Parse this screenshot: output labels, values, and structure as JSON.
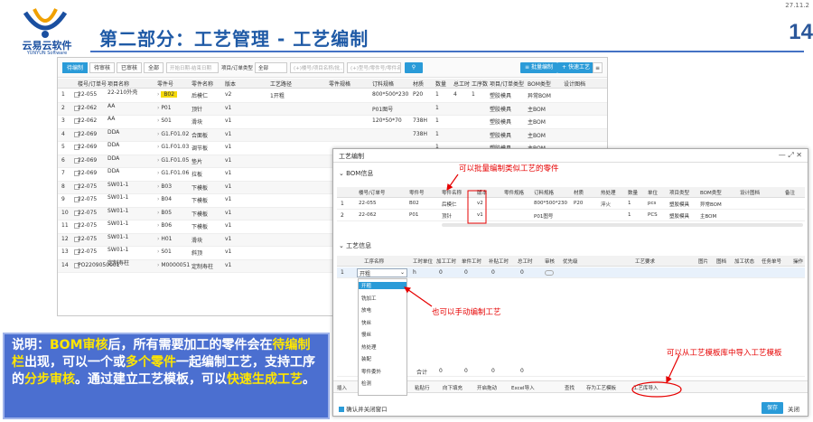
{
  "page": {
    "date": "27.11.2",
    "number": "14",
    "title": "第二部分：工艺管理 - 工艺编制"
  },
  "logo": {
    "name": "云易云软件",
    "sub": "YUNYUN Software"
  },
  "toolbar": {
    "tabs": [
      "待编制",
      "待审核",
      "已审核",
      "全部"
    ],
    "date_placeholder": "开始日期-结束日期",
    "project_label": "项目/订单类型",
    "project_value": "全部",
    "search_placeholder": "(+)楼号/项目名称/批...",
    "search2_placeholder": "(+)型号/零件号/零件名称",
    "batch_button": "批量编制",
    "quick_button": "快速工艺"
  },
  "main_table": {
    "headers": [
      "楼号/订单号",
      "项目名称",
      "零件号",
      "零件名称",
      "版本",
      "工艺路径",
      "零件规格",
      "订料规格",
      "材质",
      "数量",
      "总工时",
      "工序数",
      "项目/订单类型",
      "BOM类型",
      "设计图档"
    ],
    "rows": [
      {
        "n": "1",
        "order": "22-055",
        "project": "22-210外壳",
        "part": "B02",
        "name": "后模仁",
        "ver": "v2",
        "route": "1开粗",
        "spec": "",
        "order_spec": "800*500*230",
        "mat": "P20",
        "qty": "1",
        "hours": "4",
        "ops": "1",
        "type": "塑胶模具",
        "bom": "异常BOM"
      },
      {
        "n": "2",
        "order": "22-062",
        "project": "AA",
        "part": "P01",
        "name": "顶针",
        "ver": "v1",
        "route": "",
        "spec": "",
        "order_spec": "P01图号",
        "mat": "",
        "qty": "1",
        "hours": "",
        "ops": "",
        "type": "塑胶模具",
        "bom": "主BOM"
      },
      {
        "n": "3",
        "order": "22-062",
        "project": "AA",
        "part": "S01",
        "name": "滑块",
        "ver": "v1",
        "route": "",
        "spec": "",
        "order_spec": "120*50*70",
        "mat": "738H",
        "qty": "1",
        "hours": "",
        "ops": "",
        "type": "塑胶模具",
        "bom": "主BOM"
      },
      {
        "n": "4",
        "order": "22-069",
        "project": "DDA",
        "part": "G1.F01.02",
        "name": "合面板",
        "ver": "v1",
        "route": "",
        "spec": "",
        "order_spec": "",
        "mat": "738H",
        "qty": "1",
        "hours": "",
        "ops": "",
        "type": "塑胶模具",
        "bom": "主BOM"
      },
      {
        "n": "5",
        "order": "22-069",
        "project": "DDA",
        "part": "G1.F01.03",
        "name": "调节板",
        "ver": "v1",
        "route": "",
        "spec": "",
        "order_spec": "",
        "mat": "",
        "qty": "1",
        "hours": "",
        "ops": "",
        "type": "塑胶模具",
        "bom": "主BOM"
      },
      {
        "n": "6",
        "order": "22-069",
        "project": "DDA",
        "part": "G1.F01.05",
        "name": "垫片",
        "ver": "v1",
        "route": "",
        "spec": "",
        "order_spec": "",
        "mat": "",
        "qty": "1",
        "hours": "",
        "ops": "",
        "type": "塑胶模具",
        "bom": "主BOM"
      },
      {
        "n": "7",
        "order": "22-069",
        "project": "DDA",
        "part": "G1.F01.06",
        "name": "拉板",
        "ver": "v1",
        "route": "",
        "spec": "",
        "order_spec": "",
        "mat": "",
        "qty": "1",
        "hours": "",
        "ops": "",
        "type": "塑胶模具",
        "bom": "主BOM"
      },
      {
        "n": "8",
        "order": "22-075",
        "project": "SW01-1",
        "part": "B03",
        "name": "下模板",
        "ver": "v1",
        "route": "",
        "spec": "",
        "order_spec": "",
        "mat": "",
        "qty": "1",
        "hours": "",
        "ops": "",
        "type": "塑胶模具",
        "bom": "主BOM"
      },
      {
        "n": "9",
        "order": "22-075",
        "project": "SW01-1",
        "part": "B04",
        "name": "下模板",
        "ver": "v1",
        "route": "",
        "spec": "",
        "order_spec": "",
        "mat": "",
        "qty": "1",
        "hours": "",
        "ops": "",
        "type": "塑胶模具",
        "bom": "主BOM"
      },
      {
        "n": "10",
        "order": "22-075",
        "project": "SW01-1",
        "part": "B05",
        "name": "下模板",
        "ver": "v1",
        "route": "",
        "spec": "",
        "order_spec": "",
        "mat": "",
        "qty": "1",
        "hours": "",
        "ops": "",
        "type": "塑胶模具",
        "bom": "主BOM"
      },
      {
        "n": "11",
        "order": "22-075",
        "project": "SW01-1",
        "part": "B06",
        "name": "下模板",
        "ver": "v1",
        "route": "",
        "spec": "",
        "order_spec": "",
        "mat": "",
        "qty": "1",
        "hours": "",
        "ops": "",
        "type": "塑胶模具",
        "bom": "主BOM"
      },
      {
        "n": "12",
        "order": "22-075",
        "project": "SW01-1",
        "part": "H01",
        "name": "滑块",
        "ver": "v1",
        "route": "",
        "spec": "",
        "order_spec": "",
        "mat": "",
        "qty": "1",
        "hours": "",
        "ops": "",
        "type": "塑胶模具",
        "bom": "主BOM"
      },
      {
        "n": "13",
        "order": "22-075",
        "project": "SW01-1",
        "part": "S01",
        "name": "斜顶",
        "ver": "v1",
        "route": "",
        "spec": "",
        "order_spec": "",
        "mat": "",
        "qty": "1",
        "hours": "",
        "ops": "",
        "type": "塑胶模具",
        "bom": "主BOM"
      },
      {
        "n": "14",
        "order": "PO2209050001",
        "project": "定制寿柱",
        "part": "M0000051",
        "name": "定制寿柱",
        "ver": "v1",
        "route": "",
        "spec": "",
        "order_spec": "",
        "mat": "",
        "qty": "1",
        "hours": "",
        "ops": "",
        "type": "",
        "bom": ""
      }
    ]
  },
  "dialog": {
    "title": "工艺编制",
    "bom_section": "BOM信息",
    "bom_headers": [
      "楼号/订单号",
      "零件号",
      "零件名称",
      "版本",
      "零件规格",
      "订料规格",
      "材质",
      "热处理",
      "数量",
      "单位",
      "项目类型",
      "BOM类型",
      "设计图档",
      "备注"
    ],
    "bom_rows": [
      {
        "n": "1",
        "order": "22-055",
        "part": "B02",
        "name": "后模仁",
        "ver": "v2",
        "spec": "",
        "order_spec": "800*500*230",
        "mat": "P20",
        "heat": "淬火",
        "qty": "1",
        "unit": "pcs",
        "type": "塑胶模具",
        "bom": "异常BOM"
      },
      {
        "n": "2",
        "order": "22-062",
        "part": "P01",
        "name": "顶针",
        "ver": "v1",
        "spec": "",
        "order_spec": "P01图号",
        "mat": "",
        "heat": "",
        "qty": "1",
        "unit": "PCS",
        "type": "塑胶模具",
        "bom": "主BOM"
      }
    ],
    "process_section": "工艺信息",
    "process_headers": [
      "工序名称",
      "工时单位",
      "加工工时",
      "单件工时",
      "补贴工时",
      "总工时",
      "审核",
      "优先级",
      "工艺要求",
      "图片",
      "图档",
      "加工状态",
      "任务单号",
      "操作"
    ],
    "process_row": {
      "n": "1",
      "name": "开粗",
      "unit": "h",
      "h1": "0",
      "h2": "0",
      "h3": "0",
      "total": "0"
    },
    "dropdown": [
      "开粗",
      "铣加工",
      "放电",
      "快丝",
      "慢丝",
      "热处理",
      "装配",
      "零件委外",
      "检测"
    ],
    "total_label": "合计",
    "totals": [
      "0",
      "0",
      "0",
      "0"
    ],
    "footer_buttons": [
      "插入",
      "删除行",
      "复制行",
      "粘贴行",
      "向下填充",
      "开启拖动",
      "Excel导入",
      "查找",
      "存为工艺模板",
      "工艺库导入"
    ],
    "confirm_check": "确认并关闭窗口",
    "save": "保存",
    "close": "关闭"
  },
  "annotations": {
    "batch": "可以批量编制类似工艺的零件",
    "manual": "也可以手动编制工艺",
    "template": "可以从工艺模板库中导入工艺模板"
  },
  "note_segments": [
    {
      "t": "说明：",
      "b": false
    },
    {
      "t": "BOM审核",
      "b": true
    },
    {
      "t": "后，所有需要加工的零件会在",
      "b": false
    },
    {
      "t": "待编制栏",
      "b": true
    },
    {
      "t": "出现，可以一个或",
      "b": false
    },
    {
      "t": "多个零件",
      "b": true
    },
    {
      "t": "一起编制工艺，支持工序的",
      "b": false
    },
    {
      "t": "分步审核",
      "b": true
    },
    {
      "t": "。通过建立工艺模板，可以",
      "b": false
    },
    {
      "t": "快速生成工艺",
      "b": true
    },
    {
      "t": "。",
      "b": false
    }
  ]
}
